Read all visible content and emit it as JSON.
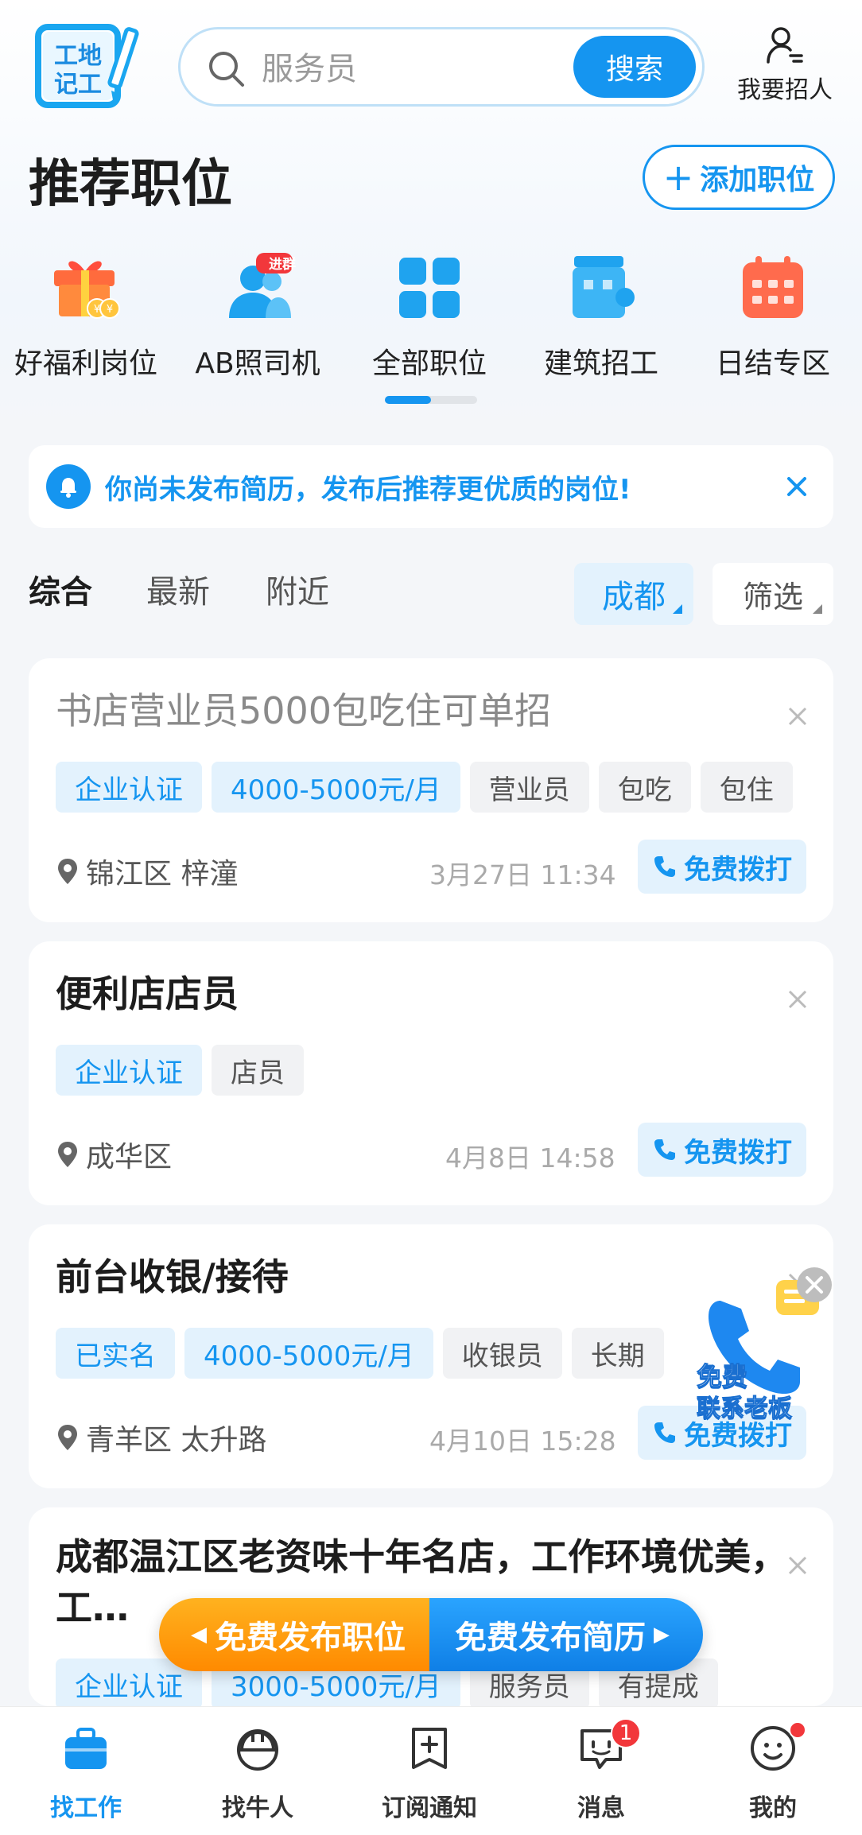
{
  "header": {
    "logo_text": "工地记工",
    "search_placeholder": "服务员",
    "search_button": "搜索",
    "recruit_label": "我要招人"
  },
  "section": {
    "title": "推荐职位",
    "add_button": "添加职位"
  },
  "categories": [
    {
      "label": "好福利岗位",
      "icon": "gift-icon"
    },
    {
      "label": "AB照司机",
      "icon": "group-icon",
      "badge": "进群"
    },
    {
      "label": "全部职位",
      "icon": "grid-icon"
    },
    {
      "label": "建筑招工",
      "icon": "building-icon"
    },
    {
      "label": "日结专区",
      "icon": "calendar-icon"
    }
  ],
  "notice": {
    "text": "你尚未发布简历，发布后推荐更优质的岗位!"
  },
  "filters": {
    "tabs": [
      "综合",
      "最新",
      "附近"
    ],
    "active_tab": "综合",
    "city": "成都",
    "filter": "筛选"
  },
  "jobs": [
    {
      "title": "书店营业员5000包吃住可单招",
      "read": true,
      "tags": [
        {
          "text": "企业认证",
          "style": "blue"
        },
        {
          "text": "4000-5000元/月",
          "style": "blue"
        },
        {
          "text": "营业员",
          "style": "gray"
        },
        {
          "text": "包吃",
          "style": "gray"
        },
        {
          "text": "包住",
          "style": "gray"
        }
      ],
      "location": "锦江区 梓潼",
      "time": "3月27日 11:34",
      "call": "免费拨打"
    },
    {
      "title": "便利店店员",
      "read": false,
      "tags": [
        {
          "text": "企业认证",
          "style": "blue"
        },
        {
          "text": "店员",
          "style": "gray"
        }
      ],
      "location": "成华区",
      "time": "4月8日 14:58",
      "call": "免费拨打"
    },
    {
      "title": "前台收银/接待",
      "read": false,
      "tags": [
        {
          "text": "已实名",
          "style": "blue"
        },
        {
          "text": "4000-5000元/月",
          "style": "blue"
        },
        {
          "text": "收银员",
          "style": "gray"
        },
        {
          "text": "长期",
          "style": "gray"
        }
      ],
      "location": "青羊区 太升路",
      "time": "4月10日 15:28",
      "call": "免费拨打"
    },
    {
      "title": "成都温江区老资味十年名店，工作环境优美，工…",
      "read": false,
      "tags": [
        {
          "text": "企业认证",
          "style": "blue"
        },
        {
          "text": "3000-5000元/月",
          "style": "blue"
        },
        {
          "text": "服务员",
          "style": "gray"
        },
        {
          "text": "有提成",
          "style": "gray"
        }
      ]
    }
  ],
  "floating_ad": {
    "line1": "免费",
    "line2": "联系老板"
  },
  "publish_bar": {
    "left": "免费发布职位",
    "right": "免费发布简历"
  },
  "bottom_nav": [
    {
      "label": "找工作",
      "icon": "briefcase-icon",
      "active": true
    },
    {
      "label": "找牛人",
      "icon": "helmet-icon"
    },
    {
      "label": "订阅通知",
      "icon": "subscribe-icon"
    },
    {
      "label": "消息",
      "icon": "message-icon",
      "badge": "1"
    },
    {
      "label": "我的",
      "icon": "profile-icon",
      "dot": true
    }
  ],
  "colors": {
    "primary": "#1595f0",
    "tag_bg": "#e3f2fd",
    "orange": "#ff8a00",
    "badge_red": "#f2373b"
  }
}
